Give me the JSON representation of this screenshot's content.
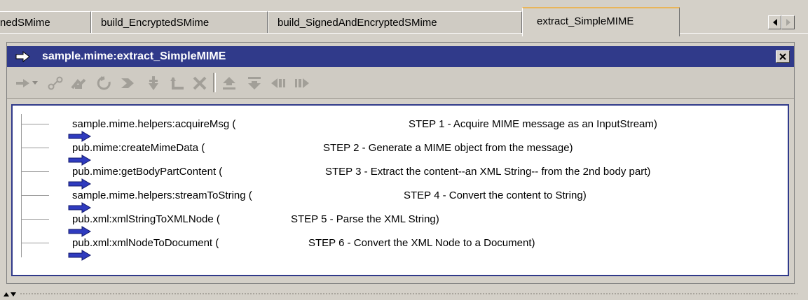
{
  "tabs": [
    {
      "label": "nedSMime"
    },
    {
      "label": "build_EncryptedSMime"
    },
    {
      "label": "build_SignedAndEncryptedSMime"
    },
    {
      "label": "extract_SimpleMIME",
      "active": true
    }
  ],
  "window": {
    "title": "sample.mime:extract_SimpleMIME"
  },
  "toolbar_icons": [
    "insert-arrow-icon",
    "dropdown-chevron-icon",
    "branch-icon",
    "loop-icon",
    "repeat-icon",
    "sequence-icon",
    "exit-icon",
    "map-icon",
    "delete-icon",
    "move-up-icon",
    "move-down-icon",
    "indent-left-icon",
    "indent-right-icon"
  ],
  "steps": [
    {
      "label": "sample.mime.helpers:acquireMsg (",
      "comment": "STEP 1 - Acquire MIME message as an InputStream)"
    },
    {
      "label": "pub.mime:createMimeData (",
      "comment": "STEP 2 - Generate a MIME object from the message)"
    },
    {
      "label": "pub.mime:getBodyPartContent (",
      "comment": "STEP 3 - Extract the content--an XML String-- from the 2nd body part)"
    },
    {
      "label": "sample.mime.helpers:streamToString (",
      "comment": "STEP 4 - Convert the content to String)"
    },
    {
      "label": "pub.xml:xmlStringToXMLNode (",
      "comment": "STEP 5 - Parse the XML String)"
    },
    {
      "label": "pub.xml:xmlNodeToDocument (",
      "comment": "STEP 6 - Convert the XML Node to a Document)"
    }
  ],
  "colors": {
    "titlebar": "#303a8a",
    "step_arrow": "#2f3bbf",
    "active_tab_accent": "#e9b55a"
  }
}
